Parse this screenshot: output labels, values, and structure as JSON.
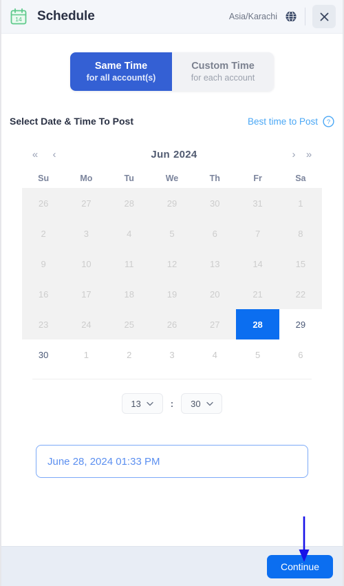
{
  "header": {
    "title": "Schedule",
    "calendar_icon_day": "14",
    "timezone": "Asia/Karachi",
    "globe_icon": "globe-icon",
    "close_icon": "close-icon"
  },
  "mode_toggle": {
    "options": [
      {
        "line1": "Same Time",
        "line2": "for all account(s)",
        "active": true
      },
      {
        "line1": "Custom Time",
        "line2": "for each account",
        "active": false
      }
    ]
  },
  "section": {
    "title": "Select Date & Time To Post",
    "best_time_label": "Best time to Post",
    "help_icon": "help-circle-icon"
  },
  "calendar": {
    "nav": {
      "prev_year": "«",
      "prev_month": "‹",
      "next_month": "›",
      "next_year": "»"
    },
    "month": "Jun",
    "year": "2024",
    "day_headers": [
      "Su",
      "Mo",
      "Tu",
      "We",
      "Th",
      "Fr",
      "Sa"
    ],
    "weeks": [
      [
        {
          "d": "26",
          "state": "disabled"
        },
        {
          "d": "27",
          "state": "disabled"
        },
        {
          "d": "28",
          "state": "disabled"
        },
        {
          "d": "29",
          "state": "disabled"
        },
        {
          "d": "30",
          "state": "disabled"
        },
        {
          "d": "31",
          "state": "disabled"
        },
        {
          "d": "1",
          "state": "disabled"
        }
      ],
      [
        {
          "d": "2",
          "state": "disabled"
        },
        {
          "d": "3",
          "state": "disabled"
        },
        {
          "d": "4",
          "state": "disabled"
        },
        {
          "d": "5",
          "state": "disabled"
        },
        {
          "d": "6",
          "state": "disabled"
        },
        {
          "d": "7",
          "state": "disabled"
        },
        {
          "d": "8",
          "state": "disabled"
        }
      ],
      [
        {
          "d": "9",
          "state": "disabled"
        },
        {
          "d": "10",
          "state": "disabled"
        },
        {
          "d": "11",
          "state": "disabled"
        },
        {
          "d": "12",
          "state": "disabled"
        },
        {
          "d": "13",
          "state": "disabled"
        },
        {
          "d": "14",
          "state": "disabled"
        },
        {
          "d": "15",
          "state": "disabled"
        }
      ],
      [
        {
          "d": "16",
          "state": "disabled"
        },
        {
          "d": "17",
          "state": "disabled"
        },
        {
          "d": "18",
          "state": "disabled"
        },
        {
          "d": "19",
          "state": "disabled"
        },
        {
          "d": "20",
          "state": "disabled"
        },
        {
          "d": "21",
          "state": "disabled"
        },
        {
          "d": "22",
          "state": "disabled"
        }
      ],
      [
        {
          "d": "23",
          "state": "disabled"
        },
        {
          "d": "24",
          "state": "disabled"
        },
        {
          "d": "25",
          "state": "disabled"
        },
        {
          "d": "26",
          "state": "disabled"
        },
        {
          "d": "27",
          "state": "disabled"
        },
        {
          "d": "28",
          "state": "selected"
        },
        {
          "d": "29",
          "state": "enabled"
        }
      ],
      [
        {
          "d": "30",
          "state": "enabled"
        },
        {
          "d": "1",
          "state": "nextmonth"
        },
        {
          "d": "2",
          "state": "nextmonth"
        },
        {
          "d": "3",
          "state": "nextmonth"
        },
        {
          "d": "4",
          "state": "nextmonth"
        },
        {
          "d": "5",
          "state": "nextmonth"
        },
        {
          "d": "6",
          "state": "nextmonth"
        }
      ]
    ]
  },
  "time": {
    "hour": "13",
    "minute": "30",
    "separator": ":",
    "chevron_icon": "chevron-down-icon"
  },
  "result": {
    "value": "June 28, 2024 01:33 PM"
  },
  "footer": {
    "continue_label": "Continue"
  },
  "annotation": {
    "arrow_color": "#1712e8",
    "points_to": "continue-button"
  },
  "colors": {
    "accent_blue": "#0b6ef0",
    "toggle_active": "#3460d4",
    "link_blue": "#4aa7f5",
    "header_bg": "#f4f6fa",
    "footer_bg": "#e8edf5",
    "calendar_icon_green": "#5ec98c"
  }
}
